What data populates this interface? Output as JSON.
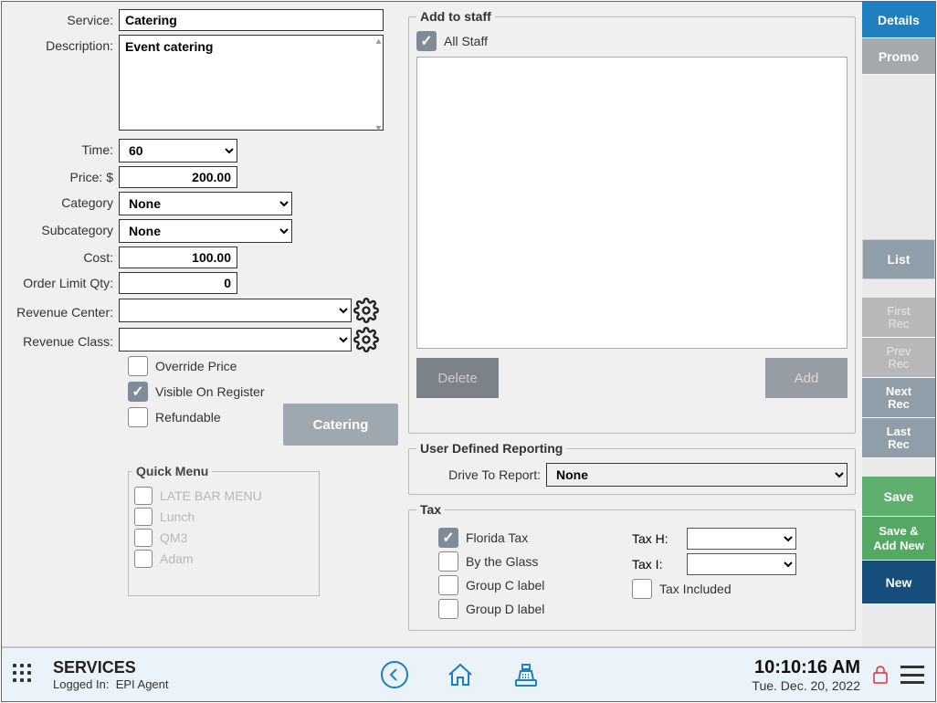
{
  "form": {
    "service_label": "Service:",
    "service_value": "Catering",
    "description_label": "Description:",
    "description_value": "Event catering",
    "time_label": "Time:",
    "time_value": "60",
    "price_label": "Price: $",
    "price_value": "200.00",
    "category_label": "Category",
    "category_value": "None",
    "subcategory_label": "Subcategory",
    "subcategory_value": "None",
    "cost_label": "Cost:",
    "cost_value": "100.00",
    "orderlimit_label": "Order Limit Qty:",
    "orderlimit_value": "0",
    "revenue_center_label": "Revenue Center:",
    "revenue_center_value": "",
    "revenue_class_label": "Revenue Class:",
    "revenue_class_value": "",
    "override_price": "Override Price",
    "visible_on_register": "Visible On Register",
    "refundable": "Refundable",
    "catering_btn": "Catering"
  },
  "quickmenu": {
    "legend": "Quick Menu",
    "items": [
      "LATE BAR MENU",
      "Lunch",
      "QM3",
      "Adam"
    ]
  },
  "staff": {
    "legend": "Add to staff",
    "all_staff": "All Staff",
    "delete": "Delete",
    "add": "Add"
  },
  "udr": {
    "legend": "User Defined Reporting",
    "drive_label": "Drive To Report:",
    "drive_value": "None"
  },
  "tax": {
    "legend": "Tax",
    "florida": "Florida Tax",
    "byglass": "By the Glass",
    "groupc": "Group C label",
    "groupd": "Group D label",
    "taxh_label": "Tax H:",
    "taxi_label": "Tax I:",
    "tax_included": "Tax Included"
  },
  "side": {
    "details": "Details",
    "promo": "Promo",
    "list": "List",
    "first": "First Rec",
    "prev": "Prev Rec",
    "next": "Next Rec",
    "last": "Last Rec",
    "save": "Save",
    "saveadd": "Save & Add New",
    "new": "New"
  },
  "footer": {
    "title": "SERVICES",
    "loggedin_label": "Logged In:",
    "loggedin_user": "EPI Agent",
    "time": "10:10:16 AM",
    "date": "Tue. Dec. 20, 2022"
  }
}
